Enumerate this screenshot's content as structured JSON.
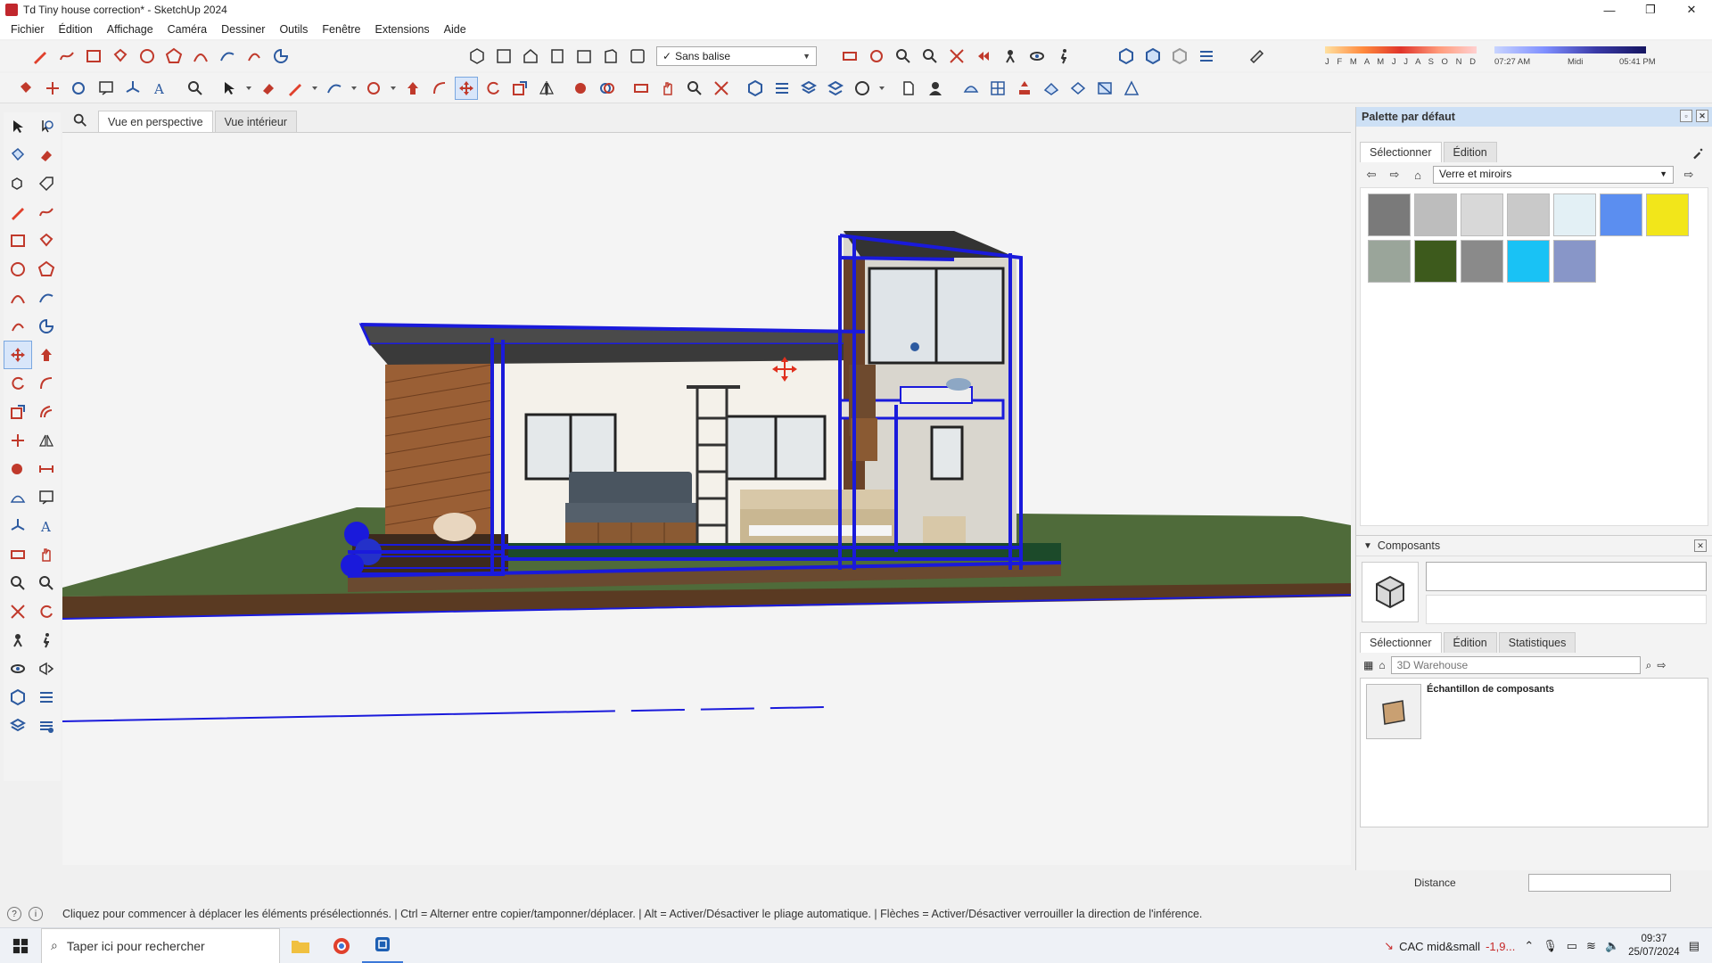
{
  "window": {
    "title": "Td Tiny house correction* - SketchUp 2024",
    "controls": {
      "minimize": "—",
      "restore": "❐",
      "close": "✕"
    }
  },
  "menu": [
    "Fichier",
    "Édition",
    "Affichage",
    "Caméra",
    "Dessiner",
    "Outils",
    "Fenêtre",
    "Extensions",
    "Aide"
  ],
  "toolbar": {
    "tag_select_value": "Sans balise",
    "shadow": {
      "months": "J F M A M J J A S O N D",
      "time_start": "07:27 AM",
      "time_mid": "Midi",
      "time_end": "05:41 PM"
    }
  },
  "scenes": {
    "tabs": [
      "Vue en perspective",
      "Vue intérieur"
    ],
    "active_index": 0
  },
  "materials_panel": {
    "title": "Palette par défaut",
    "tabs": [
      "Sélectionner",
      "Édition"
    ],
    "collection": "Verre et miroirs",
    "swatch_colors": [
      "#7a7a7a",
      "#bdbdbd",
      "#d8d8d8",
      "#c9c9c9",
      "#e3f0f5",
      "#5b8ef0",
      "#f2e61a",
      "#9aa59a",
      "#3d5a1c",
      "#8a8a8a",
      "#19c2f5",
      "#8896c8"
    ]
  },
  "components_panel": {
    "title": "Composants",
    "tabs": [
      "Sélectionner",
      "Édition",
      "Statistiques"
    ],
    "search_placeholder": "3D Warehouse",
    "item_label": "Échantillon de composants"
  },
  "measurements": {
    "label": "Distance",
    "value": ""
  },
  "status": {
    "message": "Cliquez pour commencer à déplacer les éléments présélectionnés. | Ctrl = Alterner entre copier/tamponner/déplacer. | Alt = Activer/Désactiver le pliage automatique. | Flèches = Activer/Désactiver verrouiller la direction de l'inférence."
  },
  "taskbar": {
    "search_placeholder": "Taper ici pour rechercher",
    "market_name": "CAC mid&small",
    "market_change": "-1,9...",
    "time": "09:37",
    "date": "25/07/2024"
  },
  "colors": {
    "selection": "#1a1adb",
    "ground_grass": "#4f6b3a",
    "ground_dirt": "#5a3a22",
    "wood_cladding": "#9a5f35",
    "panel_header": "#cde0f5"
  }
}
